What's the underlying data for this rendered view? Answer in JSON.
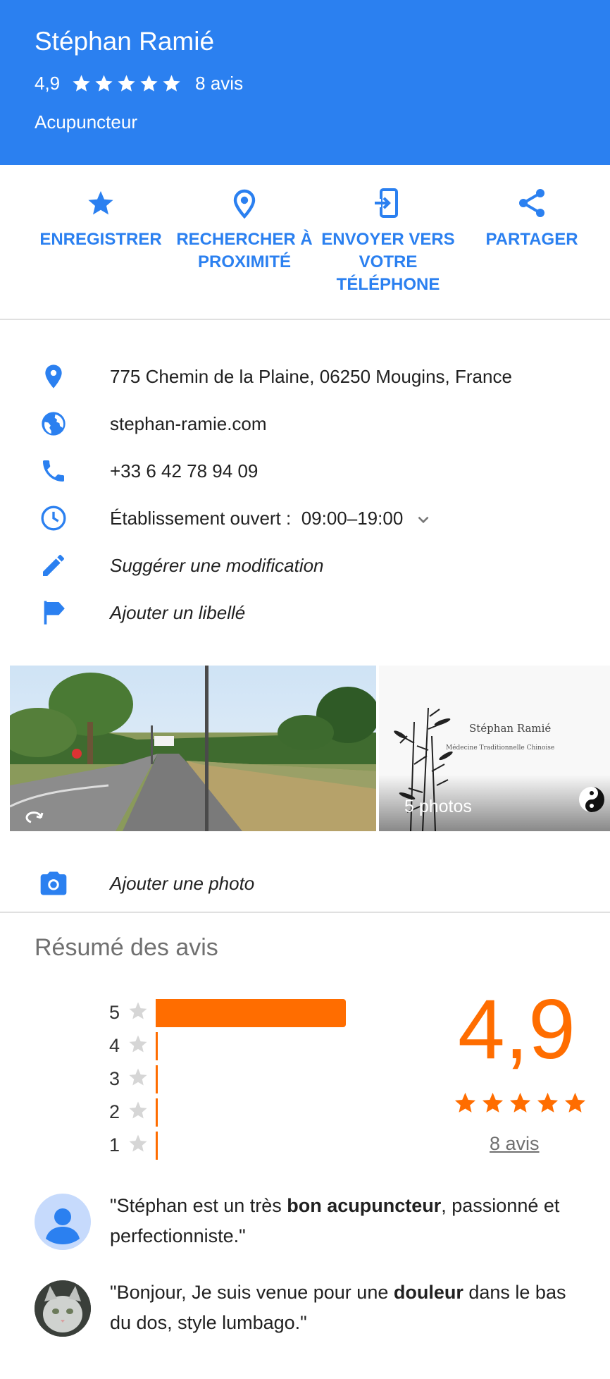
{
  "header": {
    "title": "Stéphan Ramié",
    "rating": "4,9",
    "review_count": "8 avis",
    "category": "Acupuncteur",
    "stars": 5
  },
  "actions": [
    {
      "label": "ENREGISTRER",
      "icon": "star-icon"
    },
    {
      "label": "RECHERCHER À PROXIMITÉ",
      "icon": "location-target-icon"
    },
    {
      "label": "ENVOYER VERS VOTRE TÉLÉPHONE",
      "icon": "send-to-phone-icon"
    },
    {
      "label": "PARTAGER",
      "icon": "share-icon"
    }
  ],
  "info": {
    "address": "775 Chemin de la Plaine, 06250 Mougins, France",
    "website": "stephan-ramie.com",
    "phone": "+33 6 42 78 94 09",
    "hours_label": "Établissement ouvert :",
    "hours_value": "09:00–19:00",
    "suggest_edit": "Suggérer une modification",
    "add_label": "Ajouter un libellé"
  },
  "photos": {
    "card_title": "Stéphan Ramié",
    "card_subtitle": "Médecine Traditionnelle Chinoise",
    "count_label": "5 photos"
  },
  "add_photo": "Ajouter une photo",
  "reviews_summary": {
    "title": "Résumé des avis",
    "score": "4,9",
    "count_link": "8 avis",
    "histogram": [
      {
        "stars": "5",
        "fraction": 1.0
      },
      {
        "stars": "4",
        "fraction": 0.0
      },
      {
        "stars": "3",
        "fraction": 0.0
      },
      {
        "stars": "2",
        "fraction": 0.0
      },
      {
        "stars": "1",
        "fraction": 0.0
      }
    ]
  },
  "snippets": [
    {
      "before": "\"Stéphan est un très ",
      "bold": "bon acupuncteur",
      "after": ", passionné et perfectionniste.\""
    },
    {
      "before": "\"Bonjour, Je suis venue pour une ",
      "bold": "douleur",
      "after": " dans le bas du dos, style lumbago.\""
    }
  ],
  "colors": {
    "brand_blue": "#2b80f0",
    "accent_orange": "#ff6d00",
    "muted_gray": "#707070"
  }
}
